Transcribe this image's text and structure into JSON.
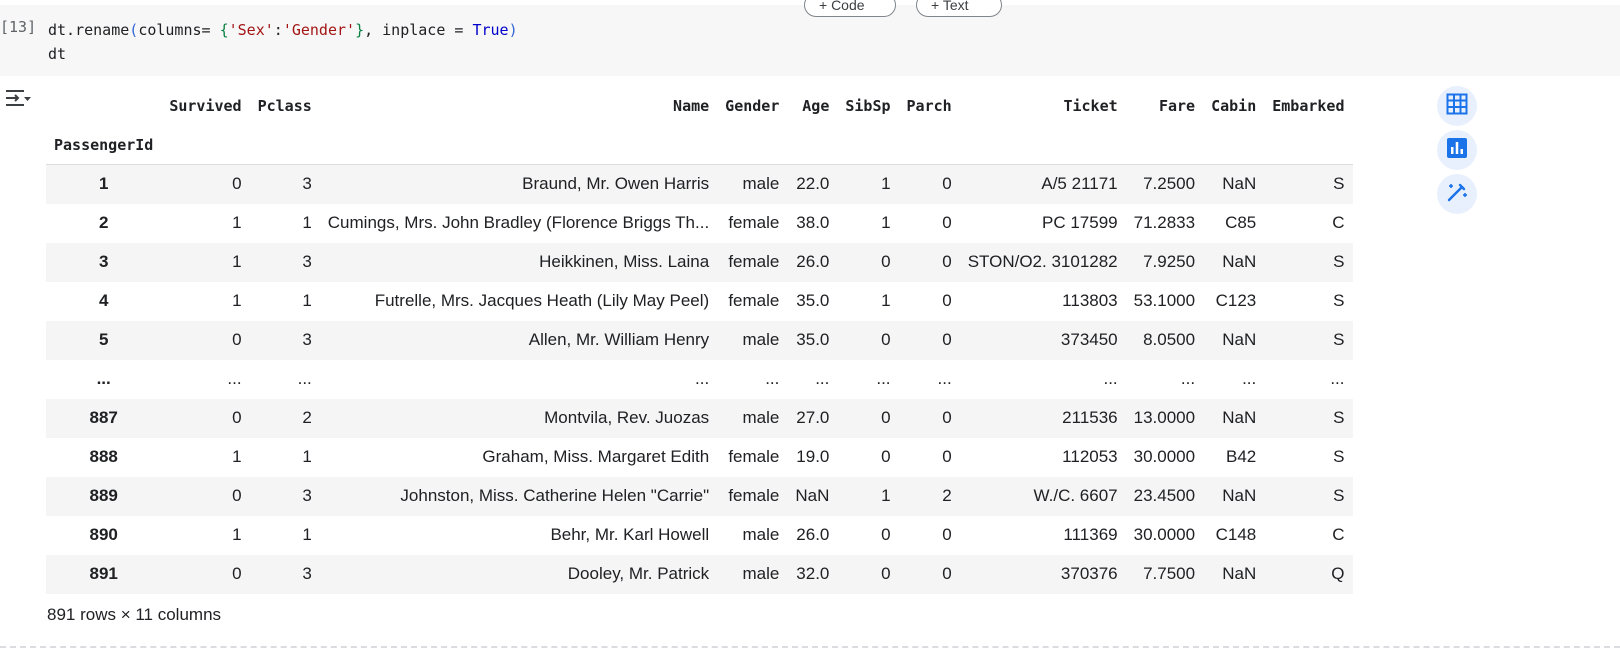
{
  "cell": {
    "execution_count": "[13]",
    "code": {
      "l1_a": "dt.rename",
      "l1_open_paren": "(",
      "l1_b": "columns= ",
      "l1_open_brace": "{",
      "l1_str_key": "'Sex'",
      "l1_colon": ":",
      "l1_str_val": "'Gender'",
      "l1_close_brace": "}",
      "l1_c": ", inplace = ",
      "l1_kw": "True",
      "l1_close_paren": ")",
      "l2": "dt"
    }
  },
  "toolbar": {
    "add_code_label": "+ Code",
    "add_text_label": "+ Text"
  },
  "dataframe": {
    "columns": [
      "Survived",
      "Pclass",
      "Name",
      "Gender",
      "Age",
      "SibSp",
      "Parch",
      "Ticket",
      "Fare",
      "Cabin",
      "Embarked"
    ],
    "index_name": "PassengerId",
    "rows": [
      {
        "index": "1",
        "cells": [
          "0",
          "3",
          "Braund, Mr. Owen Harris",
          "male",
          "22.0",
          "1",
          "0",
          "A/5 21171",
          "7.2500",
          "NaN",
          "S"
        ]
      },
      {
        "index": "2",
        "cells": [
          "1",
          "1",
          "Cumings, Mrs. John Bradley (Florence Briggs Th...",
          "female",
          "38.0",
          "1",
          "0",
          "PC 17599",
          "71.2833",
          "C85",
          "C"
        ]
      },
      {
        "index": "3",
        "cells": [
          "1",
          "3",
          "Heikkinen, Miss. Laina",
          "female",
          "26.0",
          "0",
          "0",
          "STON/O2. 3101282",
          "7.9250",
          "NaN",
          "S"
        ]
      },
      {
        "index": "4",
        "cells": [
          "1",
          "1",
          "Futrelle, Mrs. Jacques Heath (Lily May Peel)",
          "female",
          "35.0",
          "1",
          "0",
          "113803",
          "53.1000",
          "C123",
          "S"
        ]
      },
      {
        "index": "5",
        "cells": [
          "0",
          "3",
          "Allen, Mr. William Henry",
          "male",
          "35.0",
          "0",
          "0",
          "373450",
          "8.0500",
          "NaN",
          "S"
        ]
      },
      {
        "index": "...",
        "cells": [
          "...",
          "...",
          "...",
          "...",
          "...",
          "...",
          "...",
          "...",
          "...",
          "...",
          "..."
        ]
      },
      {
        "index": "887",
        "cells": [
          "0",
          "2",
          "Montvila, Rev. Juozas",
          "male",
          "27.0",
          "0",
          "0",
          "211536",
          "13.0000",
          "NaN",
          "S"
        ]
      },
      {
        "index": "888",
        "cells": [
          "1",
          "1",
          "Graham, Miss. Margaret Edith",
          "female",
          "19.0",
          "0",
          "0",
          "112053",
          "30.0000",
          "B42",
          "S"
        ]
      },
      {
        "index": "889",
        "cells": [
          "0",
          "3",
          "Johnston, Miss. Catherine Helen \"Carrie\"",
          "female",
          "NaN",
          "1",
          "2",
          "W./C. 6607",
          "23.4500",
          "NaN",
          "S"
        ]
      },
      {
        "index": "890",
        "cells": [
          "1",
          "1",
          "Behr, Mr. Karl Howell",
          "male",
          "26.0",
          "0",
          "0",
          "111369",
          "30.0000",
          "C148",
          "C"
        ]
      },
      {
        "index": "891",
        "cells": [
          "0",
          "3",
          "Dooley, Mr. Patrick",
          "male",
          "32.0",
          "0",
          "0",
          "370376",
          "7.7500",
          "NaN",
          "Q"
        ]
      }
    ],
    "shape_text": "891 rows × 11 columns"
  },
  "icons": {
    "output_toggle": "output-toggle-icon",
    "table_view": "table-icon",
    "chart_suggest": "bar-chart-icon",
    "magic_edit": "magic-wand-icon"
  },
  "colors": {
    "accent": "#1a73e8",
    "side_button_bg": "#e8f0fe",
    "odd_row_bg": "#f5f5f5",
    "code_cell_bg": "#f7f7f7"
  }
}
